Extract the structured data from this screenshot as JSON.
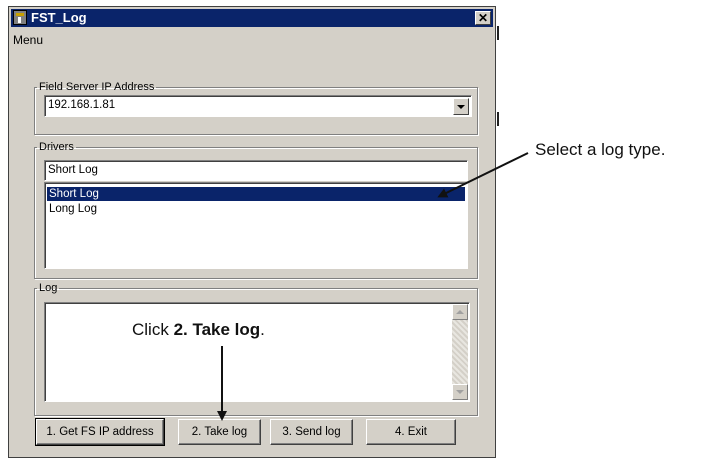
{
  "window": {
    "title": "FST_Log",
    "close_glyph": "✕",
    "menu": "Menu"
  },
  "ip_group": {
    "legend": "Field Server IP Address",
    "value": "192.168.1.81"
  },
  "drivers_group": {
    "legend": "Drivers",
    "value": "Short Log",
    "options": [
      "Short Log",
      "Long Log"
    ],
    "selected": "Short Log"
  },
  "log_group": {
    "legend": "Log",
    "content": ""
  },
  "buttons": {
    "get_ip": "1. Get FS IP address",
    "take_log": "2. Take log",
    "send_log": "3. Send log",
    "exit": "4. Exit"
  },
  "annotations": {
    "select_type": "Select a log type.",
    "click_prefix": "Click ",
    "click_bold": "2. Take log",
    "click_suffix": "."
  },
  "icons": {
    "app": "app-icon",
    "close": "close-icon",
    "dropdown": "chevron-down-icon"
  },
  "colors": {
    "titlebar": "#0a246a",
    "window": "#d4d0c8",
    "selection": "#0a246a"
  }
}
